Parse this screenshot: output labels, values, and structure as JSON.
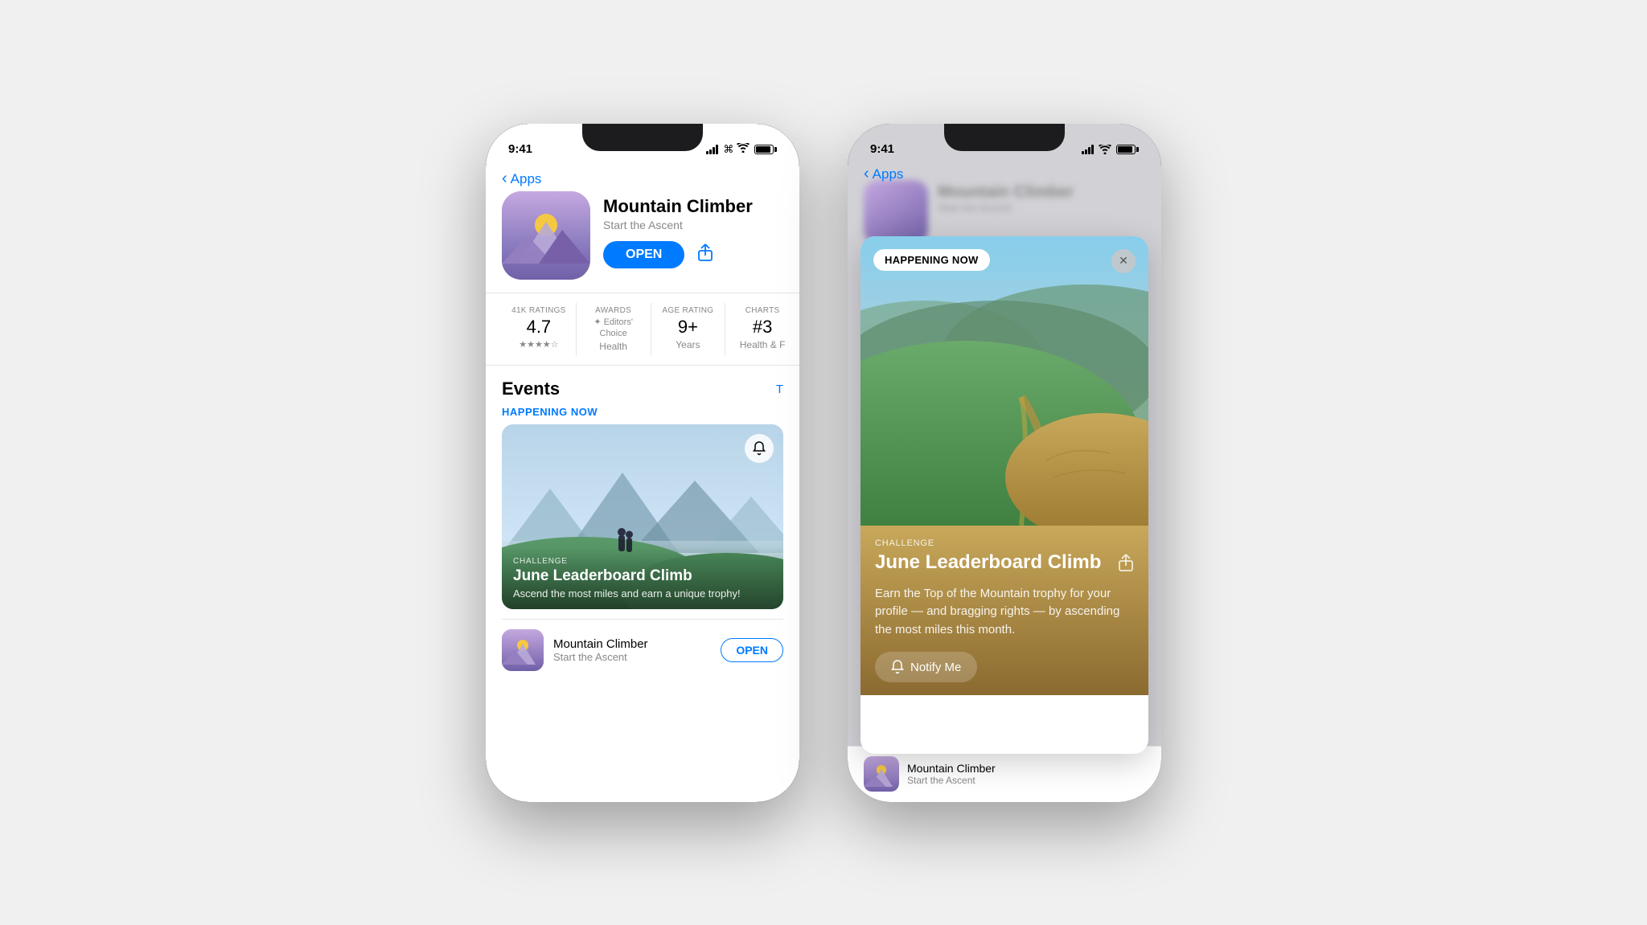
{
  "background_color": "#f0f0f0",
  "phone1": {
    "status_time": "9:41",
    "nav": {
      "back_label": "Apps",
      "back_href": "#"
    },
    "app": {
      "name": "Mountain Climber",
      "subtitle": "Start the Ascent",
      "open_button": "OPEN",
      "stats": [
        {
          "label": "41K RATINGS",
          "value": "4.7",
          "sublabel": "★★★★☆"
        },
        {
          "label": "AWARDS",
          "value": "⚜",
          "sublabel": "Editors' Choice\nHealth"
        },
        {
          "label": "AGE RATING",
          "value": "9+",
          "sublabel": "Years"
        },
        {
          "label": "CHARTS",
          "value": "#3",
          "sublabel": "Health & F"
        }
      ]
    },
    "events": {
      "title": "Events",
      "happening_now": "HAPPENING NOW",
      "see_all": "T",
      "event": {
        "type": "CHALLENGE",
        "name": "June Leaderboard Climb",
        "description": "Ascend the most miles and earn a unique trophy!"
      }
    },
    "footer": {
      "app_name": "Mountain Climber",
      "app_subtitle": "Start the Ascent",
      "open_label": "OPEN"
    }
  },
  "phone2": {
    "status_time": "9:41",
    "nav": {
      "back_label": "Apps"
    },
    "app_name_bg": "Mountain Climber",
    "modal": {
      "happening_now_badge": "HAPPENING NOW",
      "close_button": "✕",
      "event": {
        "type": "CHALLENGE",
        "name": "June Leaderboard Climb",
        "description": "Earn the Top of the Mountain trophy for your profile — and bragging rights — by ascending the most miles this month.",
        "notify_label": "Notify Me"
      }
    },
    "footer": {
      "app_name": "Mountain Climber",
      "app_subtitle": "Start the Ascent"
    }
  }
}
